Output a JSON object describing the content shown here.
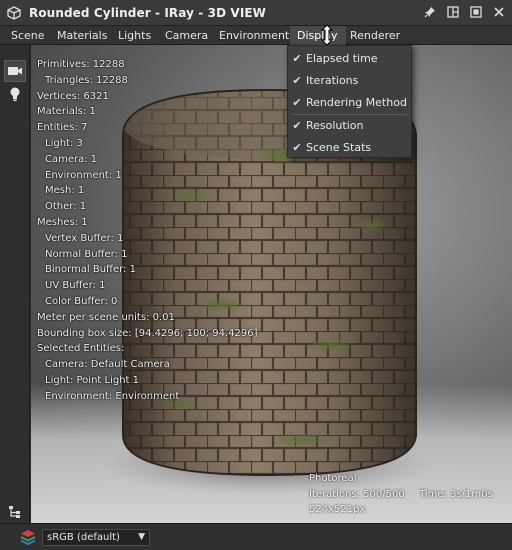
{
  "window": {
    "title": "Rounded Cylinder - IRay - 3D VIEW"
  },
  "menu": [
    "Scene",
    "Materials",
    "Lights",
    "Camera",
    "Environment",
    "Display",
    "Renderer"
  ],
  "display_menu": {
    "items": [
      {
        "label": "Elapsed time",
        "checked": true
      },
      {
        "label": "Iterations",
        "checked": true
      },
      {
        "label": "Rendering Method",
        "checked": true
      },
      {
        "label": "Resolution",
        "checked": true
      },
      {
        "label": "Scene Stats",
        "checked": true
      }
    ]
  },
  "stats": {
    "primitives": "Primitives: 12288",
    "triangles": "Triangles: 12288",
    "vertices": "Vertices: 6321",
    "materials": "Materials: 1",
    "entities": "Entities: 7",
    "light": "Light: 3",
    "camera": "Camera: 1",
    "environment": "Environment: 1",
    "mesh": "Mesh: 1",
    "other": "Other: 1",
    "meshes": "Meshes: 1",
    "vertex_buffer": "Vertex Buffer: 1",
    "normal_buffer": "Normal Buffer: 1",
    "binormal_buffer": "Binormal Buffer: 1",
    "uv_buffer": "UV Buffer: 1",
    "color_buffer": "Color Buffer: 0",
    "meter_per_unit": "Meter per scene units: 0.01",
    "bounding_box": "Bounding box size: [94.4296; 100; 94.4296]",
    "selected_entities": "Selected Entities:",
    "sel_camera": "Camera: Default Camera",
    "sel_light": "Light: Point Light 1",
    "sel_environment": "Environment: Environment"
  },
  "render_info": {
    "method": "Photoreal",
    "iterations": "Iterations: 500/500",
    "time": "Time: 3s/1m0s",
    "resolution": "524x521px"
  },
  "statusbar": {
    "color_space": "sRGB (default)"
  },
  "colors": {
    "accent_check": "#dcdcdc",
    "dropdown_bg": "#3f3f3f",
    "viewport_floor": "#d4d4d4"
  }
}
